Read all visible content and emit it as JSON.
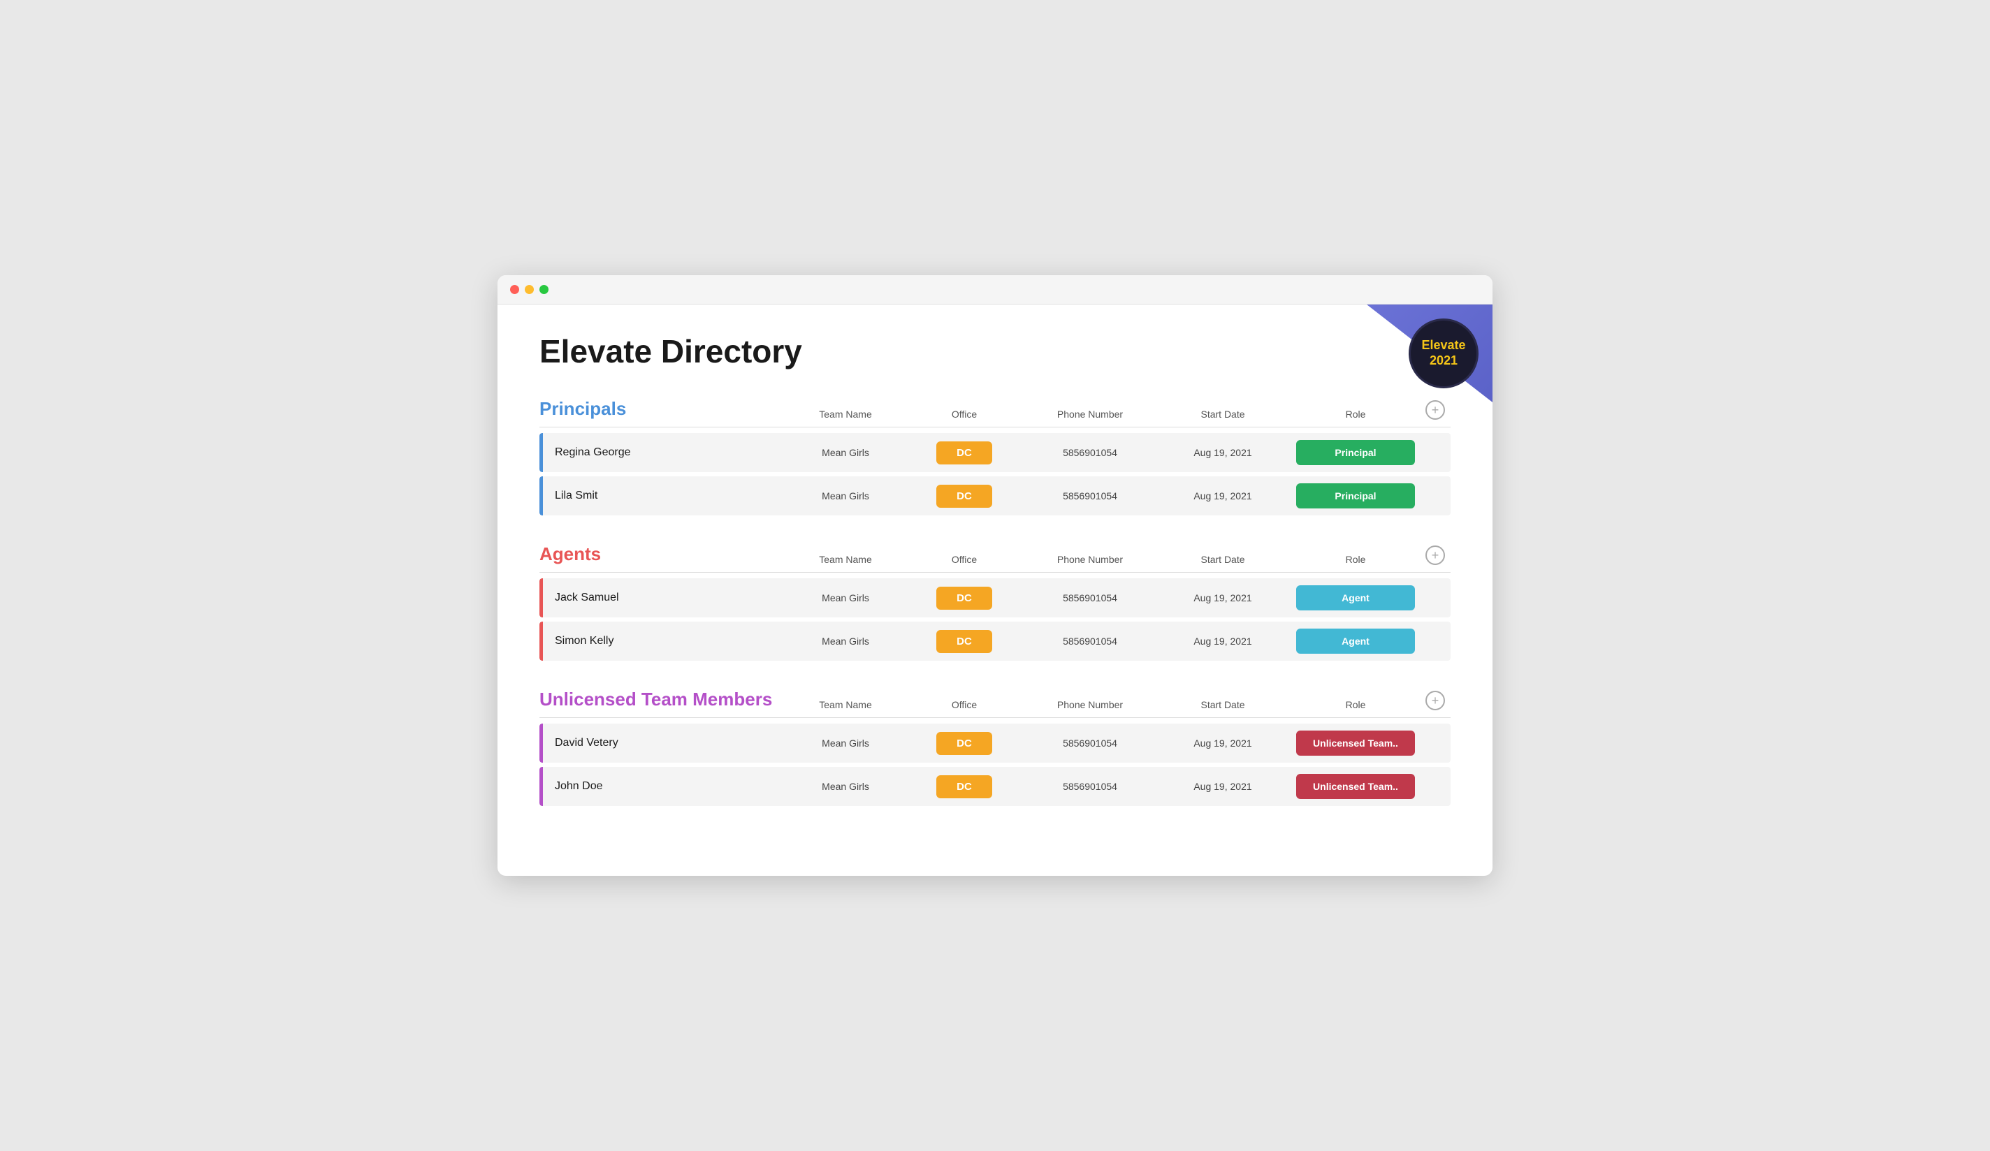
{
  "window": {
    "title": "Elevate Directory"
  },
  "badge": {
    "line1": "Elevate",
    "line2": "2021"
  },
  "page_title": "Elevate Directory",
  "sections": [
    {
      "id": "principals",
      "title": "Principals",
      "title_class": "section-title-principals",
      "accent_class": "accent-blue",
      "columns": {
        "team_name": "Team Name",
        "office": "Office",
        "phone": "Phone Number",
        "start_date": "Start Date",
        "role": "Role"
      },
      "rows": [
        {
          "name": "Regina George",
          "team": "Mean Girls",
          "office": "DC",
          "phone": "5856901054",
          "start_date": "Aug 19, 2021",
          "role": "Principal",
          "role_class": "role-principal"
        },
        {
          "name": "Lila Smit",
          "team": "Mean Girls",
          "office": "DC",
          "phone": "5856901054",
          "start_date": "Aug 19, 2021",
          "role": "Principal",
          "role_class": "role-principal"
        }
      ]
    },
    {
      "id": "agents",
      "title": "Agents",
      "title_class": "section-title-agents",
      "accent_class": "accent-red",
      "columns": {
        "team_name": "Team Name",
        "office": "Office",
        "phone": "Phone Number",
        "start_date": "Start Date",
        "role": "Role"
      },
      "rows": [
        {
          "name": "Jack Samuel",
          "team": "Mean Girls",
          "office": "DC",
          "phone": "5856901054",
          "start_date": "Aug 19, 2021",
          "role": "Agent",
          "role_class": "role-agent"
        },
        {
          "name": "Simon Kelly",
          "team": "Mean Girls",
          "office": "DC",
          "phone": "5856901054",
          "start_date": "Aug 19, 2021",
          "role": "Agent",
          "role_class": "role-agent"
        }
      ]
    },
    {
      "id": "unlicensed",
      "title": "Unlicensed Team Members",
      "title_class": "section-title-unlicensed",
      "accent_class": "accent-purple",
      "columns": {
        "team_name": "Team Name",
        "office": "Office",
        "phone": "Phone Number",
        "start_date": "Start Date",
        "role": "Role"
      },
      "rows": [
        {
          "name": "David Vetery",
          "team": "Mean Girls",
          "office": "DC",
          "phone": "5856901054",
          "start_date": "Aug 19, 2021",
          "role": "Unlicensed Team..",
          "role_class": "role-unlicensed"
        },
        {
          "name": "John Doe",
          "team": "Mean Girls",
          "office": "DC",
          "phone": "5856901054",
          "start_date": "Aug 19, 2021",
          "role": "Unlicensed Team..",
          "role_class": "role-unlicensed"
        }
      ]
    }
  ],
  "add_button_label": "+"
}
